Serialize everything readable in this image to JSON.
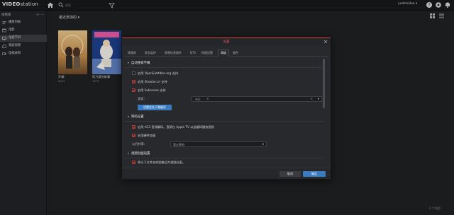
{
  "app": {
    "logo_pre": "V",
    "logo_rest": "IDEO",
    "logo_post": "station"
  },
  "topbar": {
    "search_placeholder": "搜索",
    "user_label": "yudemilao ▾"
  },
  "sidebar": {
    "header": "视频库",
    "tools": "+ ⋯",
    "items": [
      {
        "label": "播放列表"
      },
      {
        "label": "电影"
      },
      {
        "label": "电视节目"
      },
      {
        "label": "家庭视频"
      },
      {
        "label": "电视录制"
      }
    ]
  },
  "main": {
    "title": "最近添加的 ▾",
    "posters": [
      {
        "title": "开端",
        "year": "2022"
      },
      {
        "title": "阿凡提的故事",
        "year": "1979"
      }
    ],
    "footer_count": "2 个项目"
  },
  "dialog": {
    "title": "设置",
    "tabs": [
      "视频库",
      "家长监护",
      "视频信息插件",
      "DTV",
      "权限设置",
      "高级",
      "插件"
    ],
    "active_tab": "高级",
    "sections": {
      "subtitle": {
        "header": "自动搜索字幕",
        "opensubtitles": "启用 OpenSubtitles.org 支持",
        "shooter": "启用 Shooter.cn 支持",
        "subscene": "启用 Subscene 支持",
        "lang_label": "语言:",
        "lang_tag": "中文",
        "button": "设置优先下载顺序"
      },
      "transcode": {
        "header": "转码设置",
        "ac3": "启用 AC3 音频编码。直接在 Apple TV 以此编码播放视频",
        "hw": "启用硬件加速",
        "share_label": "公开共享:",
        "share_value": "禁止转码"
      },
      "cover": {
        "header": "视频封面设置",
        "use_file": "将以下文件名的图像设为视频封面。"
      }
    },
    "cancel": "取消",
    "ok": "确定"
  }
}
